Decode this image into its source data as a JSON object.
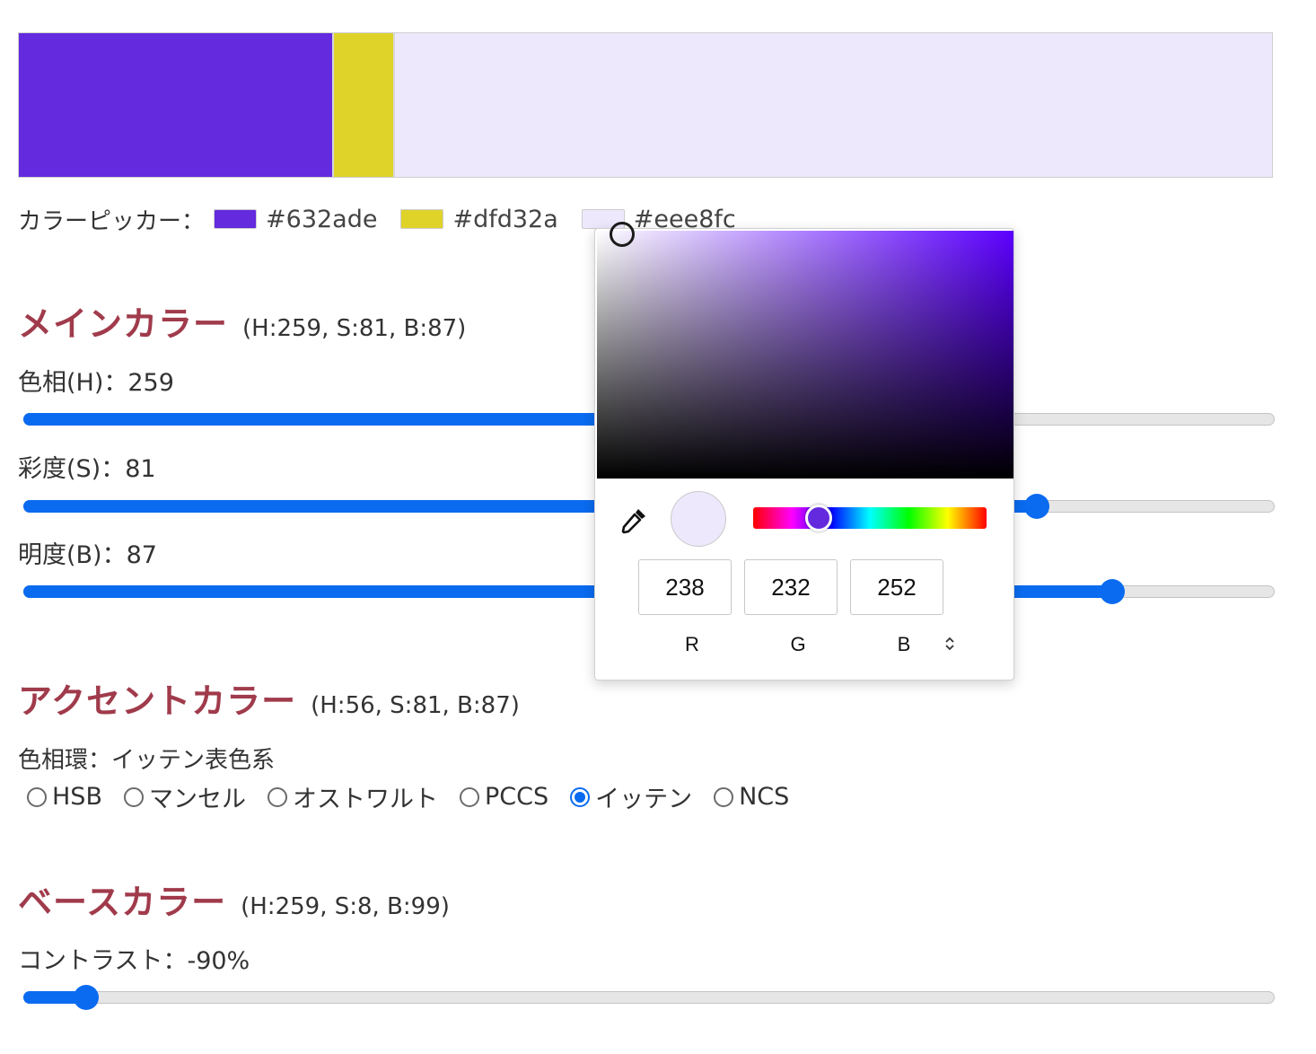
{
  "colors": {
    "main": "#632ade",
    "accent": "#dfd32a",
    "base": "#eee8fc",
    "slider_blue": "#0a6bf0",
    "title_red": "#a03b4b"
  },
  "picker_row": {
    "label": "カラーピッカー：",
    "chips": [
      {
        "hex": "#632ade"
      },
      {
        "hex": "#dfd32a"
      },
      {
        "hex": "#eee8fc"
      }
    ]
  },
  "main_section": {
    "title": "メインカラー",
    "hsb": "(H:259, S:81, B:87)",
    "hue_label": "色相(H)：259",
    "saturation_label": "彩度(S)：81",
    "brightness_label": "明度(B)：87",
    "hue_value": 259,
    "hue_max": 360,
    "saturation_value": 81,
    "brightness_value": 87
  },
  "accent_section": {
    "title": "アクセントカラー",
    "hsb": "(H:56, S:81, B:87)",
    "wheel_label": "色相環：イッテン表色系",
    "wheel_options": [
      {
        "label": "HSB",
        "checked": false
      },
      {
        "label": "マンセル",
        "checked": false
      },
      {
        "label": "オストワルト",
        "checked": false
      },
      {
        "label": "PCCS",
        "checked": false
      },
      {
        "label": "イッテン",
        "checked": true
      },
      {
        "label": "NCS",
        "checked": false
      }
    ]
  },
  "base_section": {
    "title": "ベースカラー",
    "hsb": "(H:259, S:8, B:99)",
    "contrast_label": "コントラスト：-90%",
    "contrast_value": -90
  },
  "picker_popover": {
    "icon": "eyedropper-icon",
    "hue_value": 259,
    "rgb": {
      "r": "238",
      "g": "232",
      "b": "252"
    },
    "labels": {
      "r": "R",
      "g": "G",
      "b": "B"
    },
    "mode_toggle": "⌃⌄"
  }
}
